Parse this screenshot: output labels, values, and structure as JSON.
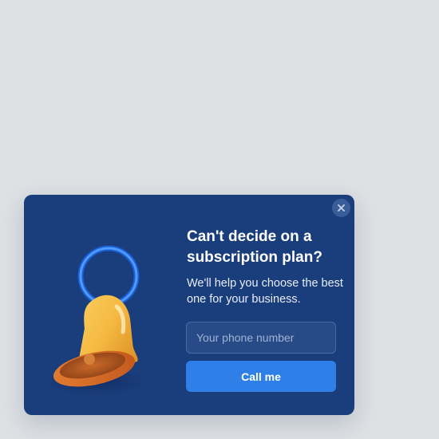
{
  "popup": {
    "headline": "Can't decide on a subscription plan?",
    "subtext": "We'll help you choose the best one for your business.",
    "phone_placeholder": "Your phone number",
    "phone_value": "",
    "cta_label": "Call me",
    "close_icon": "close-icon",
    "illustration_icon": "bell-icon"
  },
  "colors": {
    "page_background": "#dde1e4",
    "popup_background": "#1a3d7c",
    "button_accent": "#2f7fe8",
    "bell_body": "#f5b941",
    "bell_ring": "#2e7cf6"
  }
}
